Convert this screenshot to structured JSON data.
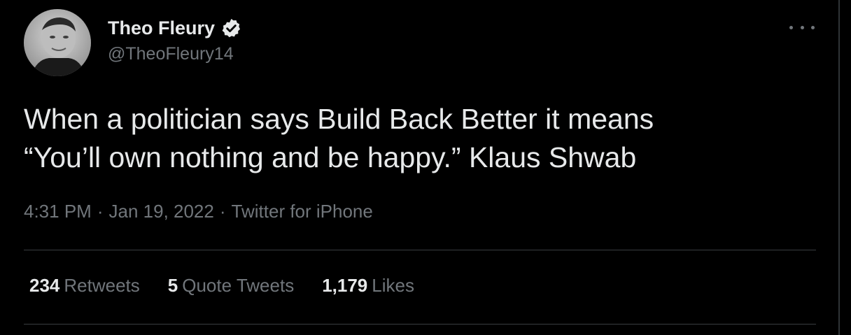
{
  "tweet": {
    "author": {
      "display_name": "Theo Fleury",
      "handle": "@TheoFleury14",
      "verified_icon": "verified-badge-icon"
    },
    "text_lines": [
      "When a politician says Build Back Better it means",
      "“You’ll own nothing and be happy.” Klaus Shwab"
    ],
    "meta": {
      "time": "4:31 PM",
      "separator": "·",
      "date": "Jan 19, 2022",
      "source": "Twitter for iPhone"
    },
    "stats": {
      "retweets": {
        "count": "234",
        "label": "Retweets"
      },
      "quote_tweets": {
        "count": "5",
        "label": "Quote Tweets"
      },
      "likes": {
        "count": "1,179",
        "label": "Likes"
      }
    },
    "more_icon": "more-horizontal-icon"
  },
  "colors": {
    "background": "#000000",
    "primary_text": "#e7e9ea",
    "secondary_text": "#71767b",
    "divider": "#3a3d40"
  }
}
